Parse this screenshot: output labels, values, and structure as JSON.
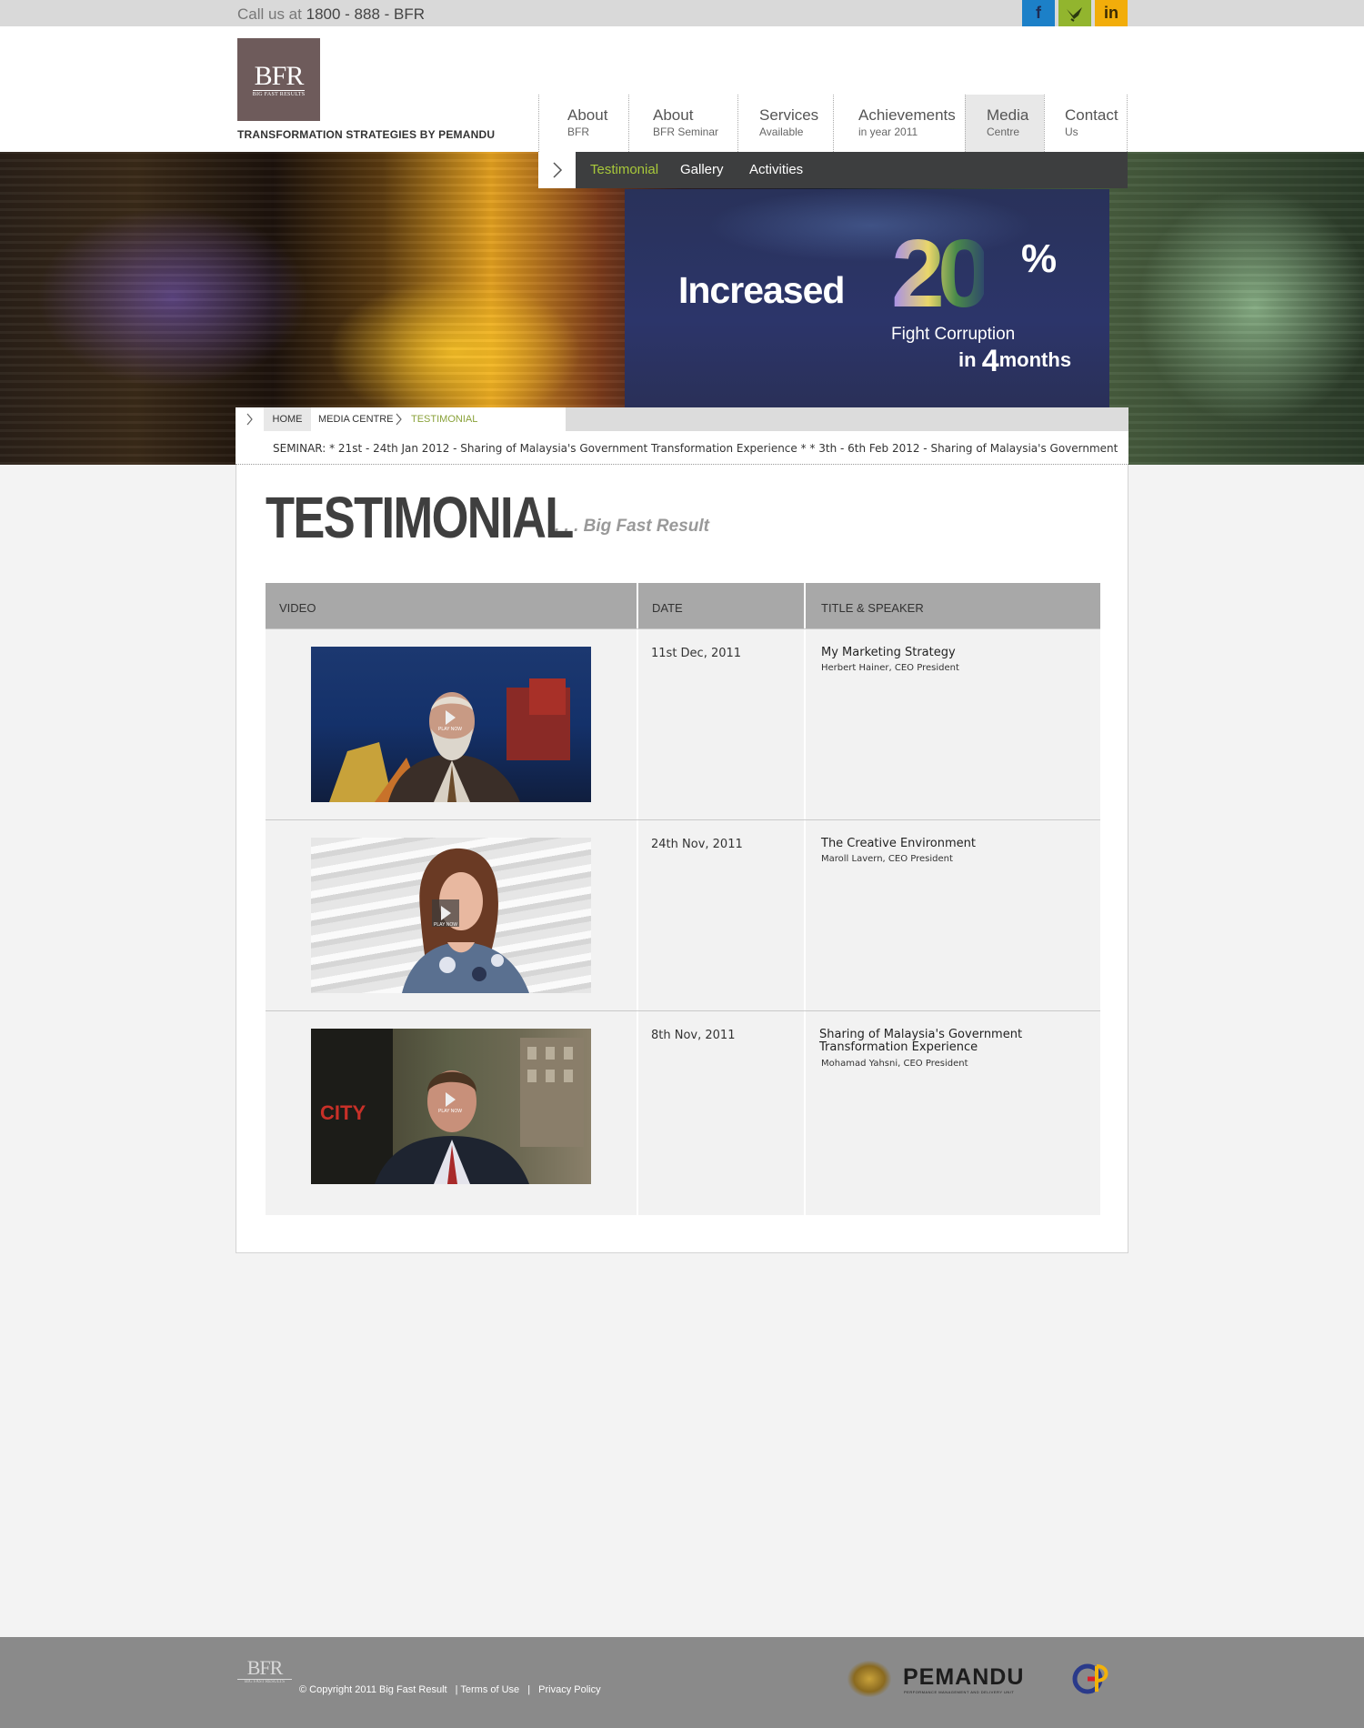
{
  "topbar": {
    "phone_prefix": "Call us at",
    "phone_number": "1800 - 888 - BFR",
    "social": [
      {
        "name": "facebook",
        "glyph": "f",
        "color": "#1c80c8"
      },
      {
        "name": "twitter",
        "glyph": "✓",
        "color": "#92b52e"
      },
      {
        "name": "linkedin",
        "glyph": "in",
        "color": "#f2ad0a"
      }
    ]
  },
  "header": {
    "logo_text": "BFR",
    "logo_subtext": "BIG FAST RESULTS",
    "tagline": "TRANSFORMATION STRATEGIES BY PEMANDU"
  },
  "nav": [
    {
      "label": "About",
      "sub": "BFR"
    },
    {
      "label": "About",
      "sub": "BFR Seminar"
    },
    {
      "label": "Services",
      "sub": "Available"
    },
    {
      "label": "Achievements",
      "sub": "in year 2011"
    },
    {
      "label": "Media",
      "sub": "Centre",
      "active": true
    },
    {
      "label": "Contact",
      "sub": "Us"
    }
  ],
  "subnav": [
    {
      "label": "Testimonial",
      "active": true
    },
    {
      "label": "Gallery"
    },
    {
      "label": "Activities"
    }
  ],
  "promo": {
    "lead": "Increased",
    "figure": "20",
    "unit": "%",
    "caption": "Fight Corruption",
    "period_prefix": "in",
    "period_number": "4",
    "period_suffix": "months"
  },
  "breadcrumb": {
    "home": "HOME",
    "section": "MEDIA CENTRE",
    "current": "TESTIMONIAL"
  },
  "ticker": "SEMINAR: * 21st - 24th Jan 2012 - Sharing of Malaysia's Government Transformation Experience *  * 3th - 6th Feb 2012 - Sharing of Malaysia's Government",
  "page": {
    "title": "TESTIMONIAL",
    "subtitle": ". . . Big Fast Result"
  },
  "table": {
    "headers": [
      "VIDEO",
      "DATE",
      "TITLE & SPEAKER"
    ],
    "play_label": "PLAY NOW",
    "rows": [
      {
        "date": "11st Dec, 2011",
        "title": "My Marketing Strategy",
        "speaker": "Herbert Hainer, CEO President"
      },
      {
        "date": "24th Nov, 2011",
        "title": "The Creative Environment",
        "speaker": "Maroll Lavern, CEO President"
      },
      {
        "date": "8th Nov, 2011",
        "title": "Sharing of Malaysia's Government Transformation Experience",
        "speaker": "Mohamad Yahsni, CEO President"
      }
    ]
  },
  "footer": {
    "logo_text": "BFR",
    "logo_subtext": "BIG FAST RESULTS",
    "copyright": "© Copyright 2011 Big Fast Result",
    "links": [
      "| Terms of Use",
      "|",
      "Privacy Policy"
    ],
    "partner_name": "PEMANDU",
    "partner_sub": "PERFORMANCE MANAGEMENT AND DELIVERY UNIT"
  },
  "colors": {
    "accent": "#a8c83a",
    "header_bg": "#ffffff",
    "subnav_bg": "#3d3e3f",
    "table_header_bg": "#a8a8a8",
    "footer_bg": "#8a8a8a",
    "logo_bg": "#6e5b5b"
  }
}
